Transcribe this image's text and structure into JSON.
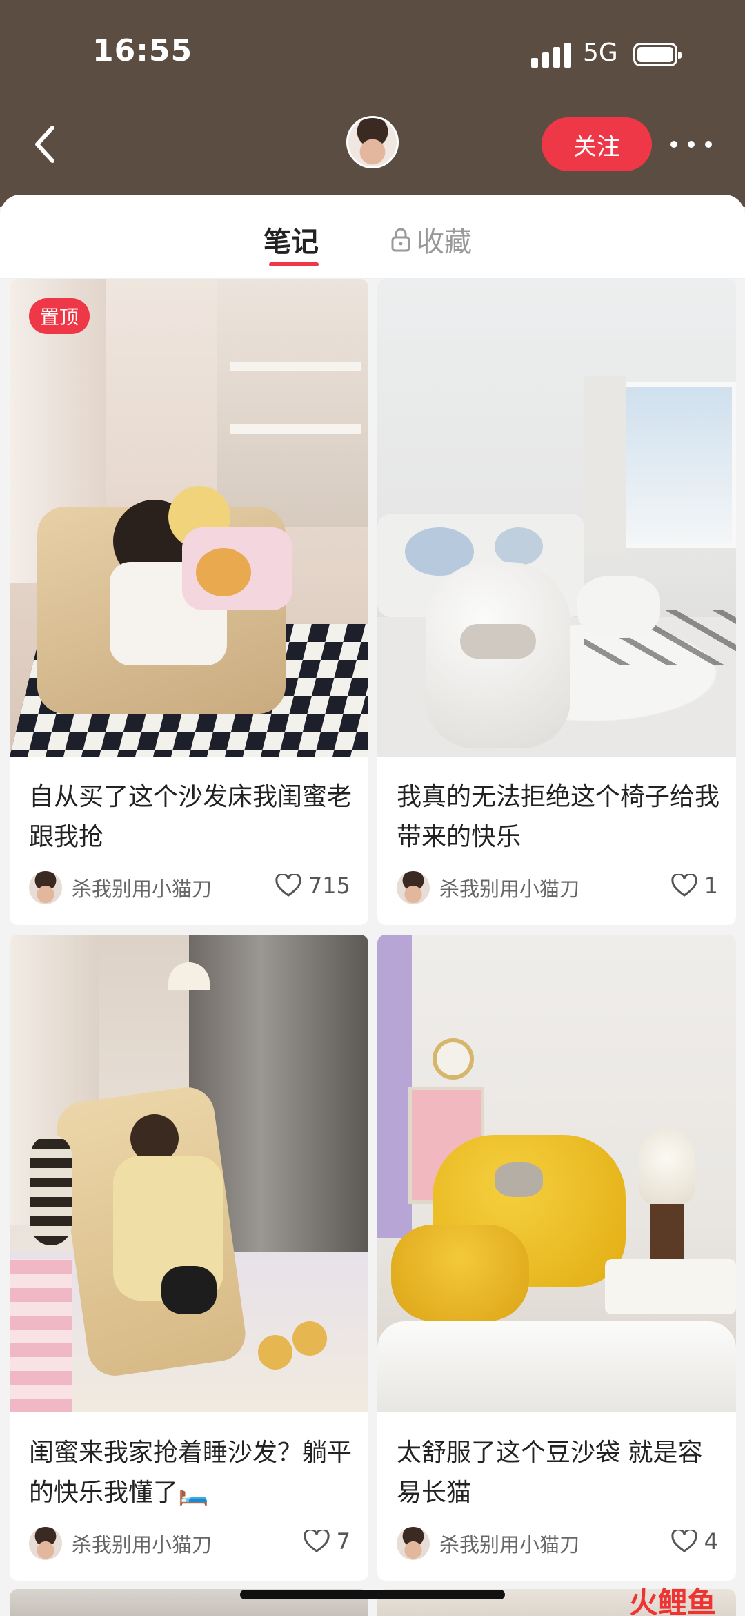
{
  "status_bar": {
    "time": "16:55",
    "network": "5G"
  },
  "header": {
    "follow_label": "关注",
    "icons": [
      "back-icon",
      "more-icon"
    ]
  },
  "tabs": [
    {
      "label": "笔记",
      "active": true
    },
    {
      "label": "收藏",
      "locked": true
    }
  ],
  "notes": [
    {
      "title": "自从买了这个沙发床我闺蜜老跟我抢",
      "author": "杀我别用小猫刀",
      "likes": "715",
      "pinned_label": "置顶"
    },
    {
      "title": "我真的无法拒绝这个椅子给我带来的快乐",
      "author": "杀我别用小猫刀",
      "likes": "1"
    },
    {
      "title": "闺蜜来我家抢着睡沙发？躺平的快乐我懂了🛏️",
      "author": "杀我别用小猫刀",
      "likes": "7"
    },
    {
      "title": "太舒服了这个豆沙袋 就是容易长猫",
      "author": "杀我别用小猫刀",
      "likes": "4"
    }
  ],
  "watermark": "火鲤鱼",
  "colors": {
    "header_bg": "#5c4d42",
    "accent": "#ee3848",
    "page_bg": "#f3f3f3"
  }
}
